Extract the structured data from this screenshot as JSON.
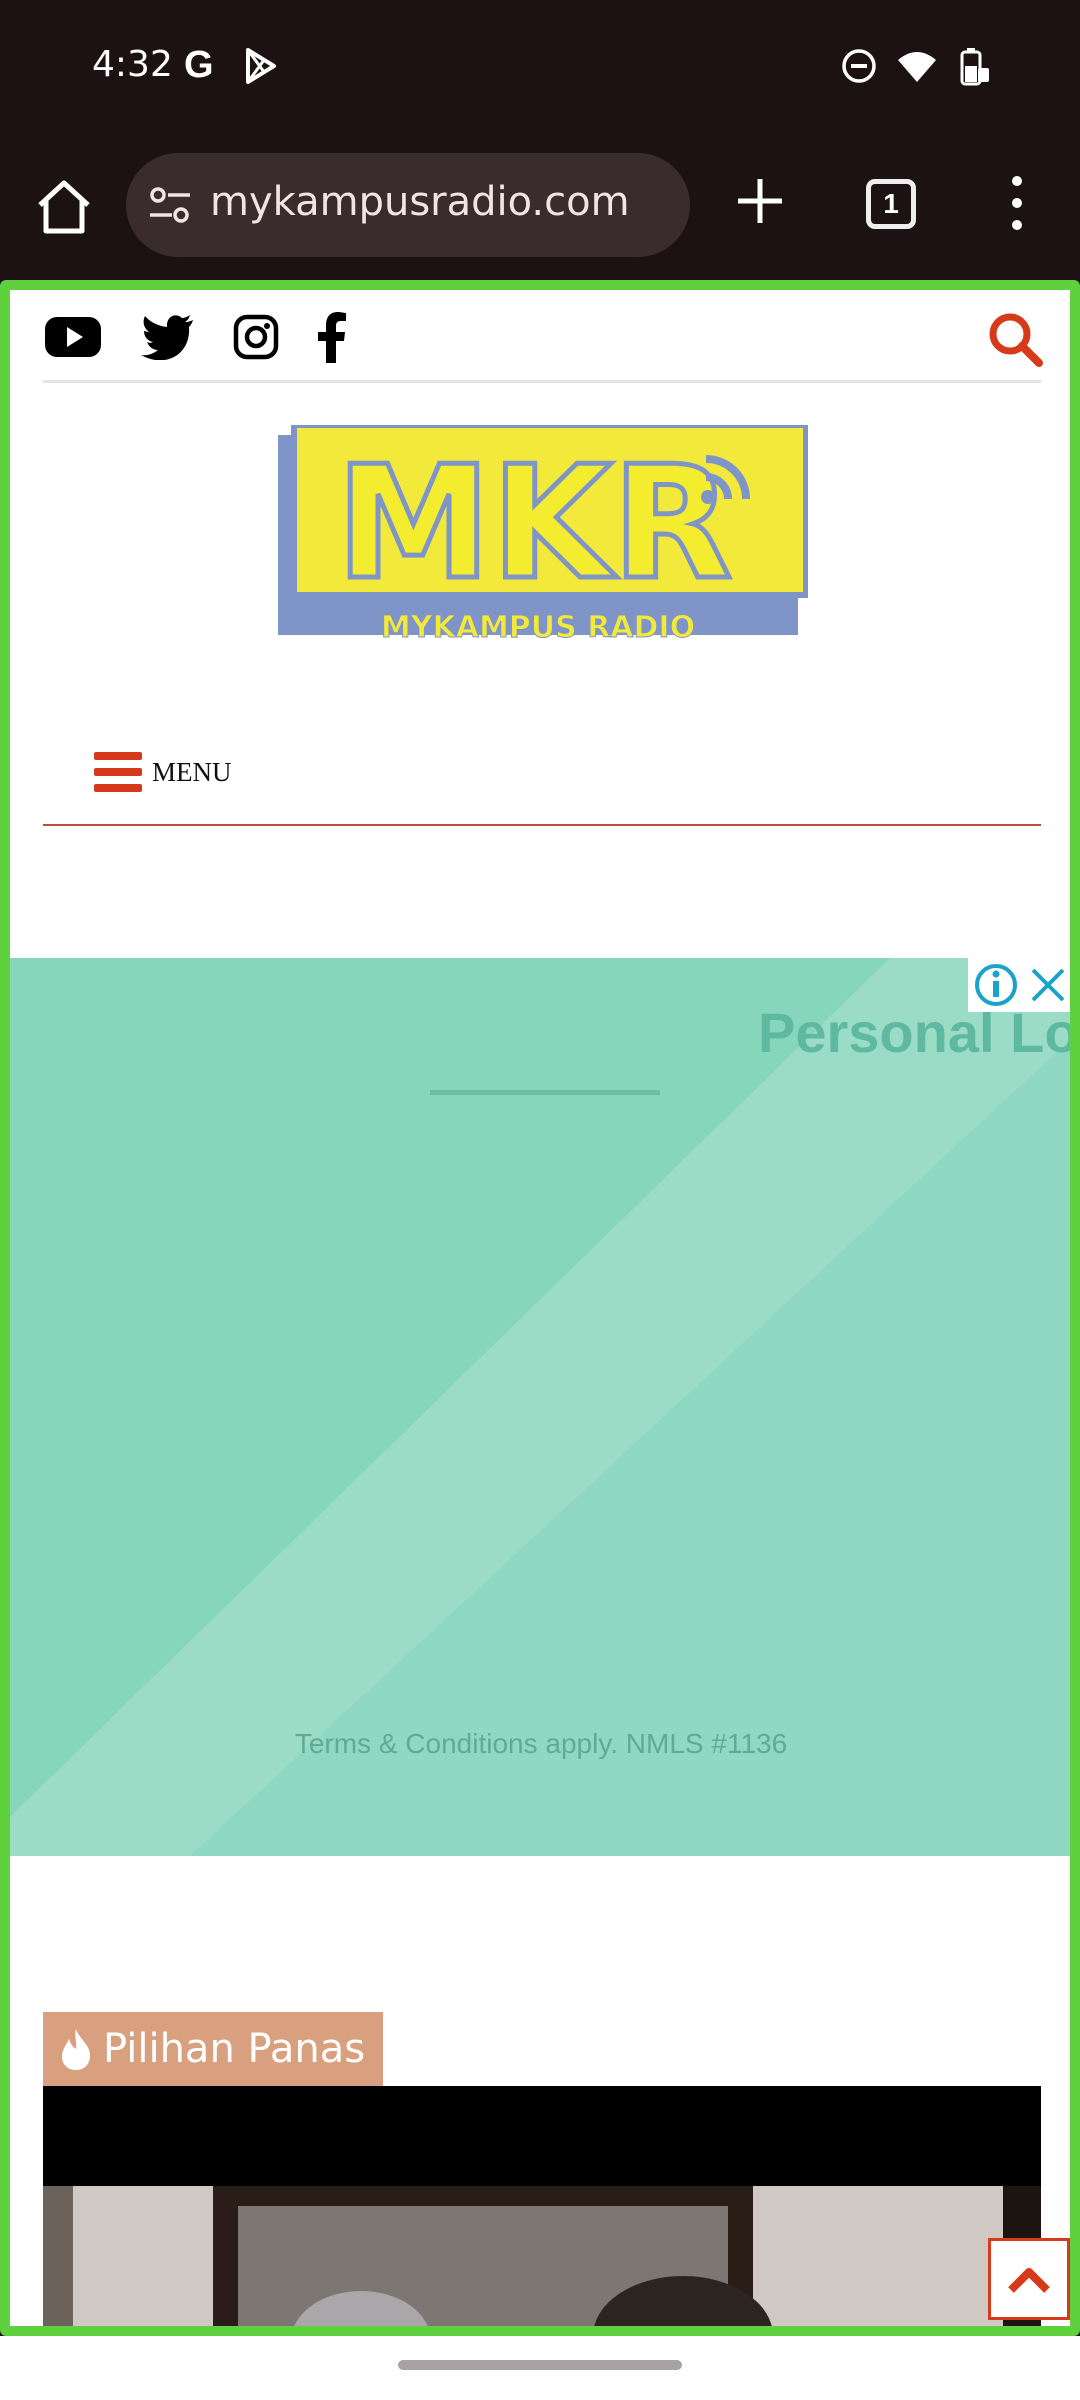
{
  "status_bar": {
    "time": "4:32",
    "google_glyph": "G",
    "left_icons": [
      "google-icon",
      "play-store-icon"
    ],
    "right_icons": [
      "do-not-disturb-icon",
      "wifi-icon",
      "battery-icon"
    ]
  },
  "browser": {
    "url": "mykampusradio.com",
    "tab_count": "1",
    "icons": [
      "home-icon",
      "site-settings-icon",
      "new-tab-icon",
      "tab-switcher-icon",
      "more-options-icon"
    ]
  },
  "site": {
    "social_icons": [
      "youtube-icon",
      "twitter-icon",
      "instagram-icon",
      "facebook-icon"
    ],
    "logo_text": "MKR",
    "logo_subtext": "MYKAMPUS RADIO",
    "menu_label": "MENU",
    "accent_color": "#d63a1a"
  },
  "ad": {
    "title": "Personal Loa",
    "terms": "Terms & Conditions apply. NMLS #1136",
    "background": "#86d6bc",
    "controls": [
      "ad-info-icon",
      "ad-close-icon"
    ]
  },
  "section": {
    "badge_label": "Pilihan Panas",
    "badge_color": "#d9a07f",
    "badge_icon": "fire-icon"
  }
}
